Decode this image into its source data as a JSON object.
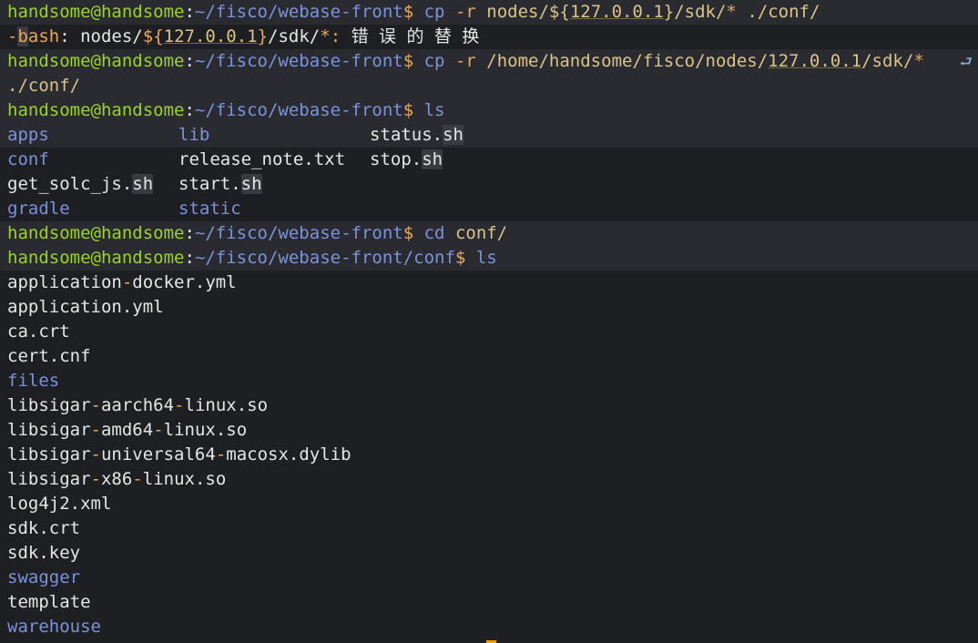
{
  "prompt": {
    "user": "handsome@handsome",
    "colon": ":",
    "dir_front": "~/fisco/webase-front",
    "dir_conf": "~/fisco/webase-front/conf",
    "dollar": "$"
  },
  "cmd1": {
    "cmd": "cp",
    "flag": "-r",
    "src_pre": "nodes/${",
    "ip": "127.0.0.1",
    "src_post": "}/sdk/",
    "star": "*",
    "dest": "./conf/"
  },
  "error": {
    "prefix": "-",
    "bash_b": "b",
    "bash_rest": "ash",
    "rest1": ": nodes/",
    "var_open": "${",
    "ip": "127.0.0.1",
    "var_close": "}",
    "rest2": "/sdk/",
    "star": "*",
    "colon": ":",
    "message": " 错 误 的 替 换"
  },
  "cmd2": {
    "cmd": "cp",
    "flag": "-r",
    "src_pre": "/home/handsome/fisco/nodes/",
    "ip": "127.0.0.1",
    "src_post": "/sdk/",
    "star": "*",
    "wrap_icon": "↩-icon",
    "wrap_glyph": "⮐",
    "dest": "./conf/"
  },
  "cmd3": {
    "cmd": "ls"
  },
  "ls_front": {
    "row1": {
      "c1": "apps",
      "c2": "lib",
      "c3_pre": "status.",
      "c3_ext": "sh"
    },
    "row2": {
      "c1": "conf",
      "c2": "release_note.txt",
      "c3_pre": "stop.",
      "c3_ext": "sh"
    },
    "row3": {
      "c1_pre": "get_solc_js.",
      "c1_ext": "sh",
      "c2_pre": "start.",
      "c2_ext": "sh"
    },
    "row4": {
      "c1": "gradle",
      "c2": "static"
    }
  },
  "cmd4": {
    "cmd": "cd",
    "arg": "conf/"
  },
  "cmd5": {
    "cmd": "ls"
  },
  "ls_conf": {
    "f1a": "application",
    "f1b": "-",
    "f1c": "docker.yml",
    "f2": "application.yml",
    "f3": "ca.crt",
    "f4": "cert.cnf",
    "f5": "files",
    "f6a": "libsigar",
    "f6b": "-",
    "f6c": "aarch64",
    "f6d": "-",
    "f6e": "linux.so",
    "f7a": "libsigar",
    "f7b": "-",
    "f7c": "amd64",
    "f7d": "-",
    "f7e": "linux.so",
    "f8a": "libsigar",
    "f8b": "-",
    "f8c": "universal64",
    "f8d": "-",
    "f8e": "macosx.dylib",
    "f9a": "libsigar",
    "f9b": "-",
    "f9c": "x86",
    "f9d": "-",
    "f9e": "linux.so",
    "f10": "log4j2.xml",
    "f11": "sdk.crt",
    "f12": "sdk.key",
    "f13": "swagger",
    "f14": "template",
    "f15": "warehouse"
  },
  "colors": {
    "background": "#1e1f22",
    "user": "#9bd22c",
    "path": "#7b93db",
    "accent": "#e8a85c",
    "text": "#e6e6e6"
  }
}
